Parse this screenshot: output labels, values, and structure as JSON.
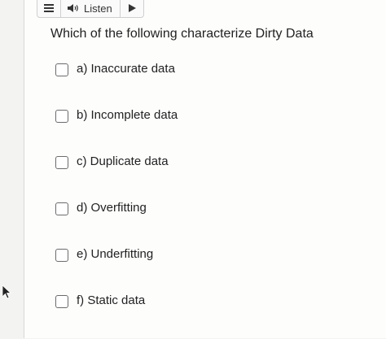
{
  "listen_bar": {
    "listen_label": "Listen",
    "menu_icon": "hamburger-menu-icon",
    "speaker_icon": "speaker-icon",
    "play_icon": "play-icon"
  },
  "question": {
    "text": "Which of the following characterize Dirty Data"
  },
  "options": [
    {
      "label": "a) Inaccurate data"
    },
    {
      "label": "b) Incomplete data"
    },
    {
      "label": "c) Duplicate data"
    },
    {
      "label": "d) Overfitting"
    },
    {
      "label": "e) Underfitting"
    },
    {
      "label": "f) Static data"
    }
  ]
}
